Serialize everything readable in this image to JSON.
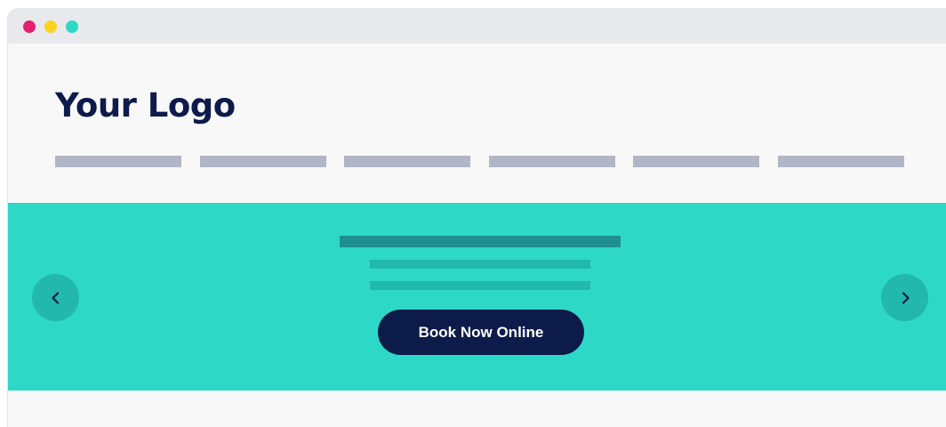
{
  "window": {
    "controls": [
      {
        "name": "close",
        "color": "#e5206f"
      },
      {
        "name": "minimize",
        "color": "#ffd21f"
      },
      {
        "name": "maximize",
        "color": "#2fd8c5"
      }
    ]
  },
  "header": {
    "logo_text": "Your Logo",
    "logo_color": "#0c1b4a",
    "nav_placeholder_count": 6,
    "nav_placeholder_color": "#b1b6c6"
  },
  "hero": {
    "background_color": "#2ed8c6",
    "heading_placeholder_color": "#1e8f90",
    "subtext_placeholder_color": "#22b8ab",
    "cta_label": "Book Now Online",
    "cta_color": "#0c1b4a",
    "prev_icon": "chevron-left-icon",
    "next_icon": "chevron-right-icon",
    "arrow_button_color": "#22b8ab",
    "arrow_icon_color": "#0c1b4a"
  }
}
